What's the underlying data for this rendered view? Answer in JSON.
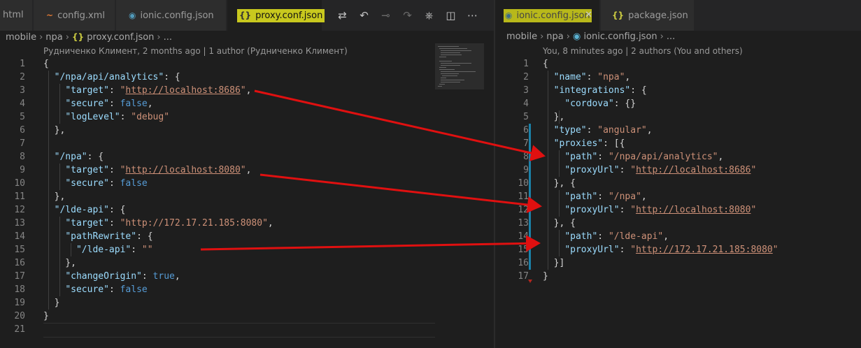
{
  "left": {
    "tabs": [
      {
        "label": "html"
      },
      {
        "label": "config.xml",
        "icon": "~"
      },
      {
        "label": "ionic.config.json",
        "icon": "◉"
      },
      {
        "label": "proxy.conf.json",
        "icon": "{}"
      }
    ],
    "breadcrumb": [
      "mobile",
      "npa",
      "proxy.conf.json",
      "..."
    ],
    "breadcrumb_icon": "{}",
    "codelens": "Рудниченко Климент, 2 months ago | 1 author (Рудниченко Климент)",
    "lines": [
      {
        "n": "1",
        "segs": [
          [
            "p",
            "{"
          ]
        ]
      },
      {
        "n": "2",
        "segs": [
          [
            "p",
            "  "
          ],
          [
            "k",
            "\"/npa/api/analytics\""
          ],
          [
            "p",
            ": {"
          ]
        ]
      },
      {
        "n": "3",
        "segs": [
          [
            "p",
            "    "
          ],
          [
            "k",
            "\"target\""
          ],
          [
            "p",
            ": "
          ],
          [
            "s",
            "\""
          ],
          [
            "u",
            "http://localhost:8686"
          ],
          [
            "s",
            "\""
          ],
          [
            "p",
            ","
          ]
        ]
      },
      {
        "n": "4",
        "segs": [
          [
            "p",
            "    "
          ],
          [
            "k",
            "\"secure\""
          ],
          [
            "p",
            ": "
          ],
          [
            "b",
            "false"
          ],
          [
            "p",
            ","
          ]
        ]
      },
      {
        "n": "5",
        "segs": [
          [
            "p",
            "    "
          ],
          [
            "k",
            "\"logLevel\""
          ],
          [
            "p",
            ": "
          ],
          [
            "s",
            "\"debug\""
          ]
        ]
      },
      {
        "n": "6",
        "segs": [
          [
            "p",
            "  },"
          ]
        ]
      },
      {
        "n": "7",
        "segs": []
      },
      {
        "n": "8",
        "segs": [
          [
            "p",
            "  "
          ],
          [
            "k",
            "\"/npa\""
          ],
          [
            "p",
            ": {"
          ]
        ]
      },
      {
        "n": "9",
        "segs": [
          [
            "p",
            "    "
          ],
          [
            "k",
            "\"target\""
          ],
          [
            "p",
            ": "
          ],
          [
            "s",
            "\""
          ],
          [
            "u",
            "http://localhost:8080"
          ],
          [
            "s",
            "\""
          ],
          [
            "p",
            ","
          ]
        ]
      },
      {
        "n": "10",
        "segs": [
          [
            "p",
            "    "
          ],
          [
            "k",
            "\"secure\""
          ],
          [
            "p",
            ": "
          ],
          [
            "b",
            "false"
          ]
        ]
      },
      {
        "n": "11",
        "segs": [
          [
            "p",
            "  },"
          ]
        ]
      },
      {
        "n": "12",
        "segs": [
          [
            "p",
            "  "
          ],
          [
            "k",
            "\"/lde-api\""
          ],
          [
            "p",
            ": {"
          ]
        ]
      },
      {
        "n": "13",
        "segs": [
          [
            "p",
            "    "
          ],
          [
            "k",
            "\"target\""
          ],
          [
            "p",
            ": "
          ],
          [
            "s",
            "\"http://172.17.21.185:8080\""
          ],
          [
            "p",
            ","
          ]
        ]
      },
      {
        "n": "14",
        "segs": [
          [
            "p",
            "    "
          ],
          [
            "k",
            "\"pathRewrite\""
          ],
          [
            "p",
            ": {"
          ]
        ]
      },
      {
        "n": "15",
        "segs": [
          [
            "p",
            "      "
          ],
          [
            "k",
            "\"/lde-api\""
          ],
          [
            "p",
            ": "
          ],
          [
            "s",
            "\"\""
          ]
        ]
      },
      {
        "n": "16",
        "segs": [
          [
            "p",
            "    },"
          ]
        ]
      },
      {
        "n": "17",
        "segs": [
          [
            "p",
            "    "
          ],
          [
            "k",
            "\"changeOrigin\""
          ],
          [
            "p",
            ": "
          ],
          [
            "b",
            "true"
          ],
          [
            "p",
            ","
          ]
        ]
      },
      {
        "n": "18",
        "segs": [
          [
            "p",
            "    "
          ],
          [
            "k",
            "\"secure\""
          ],
          [
            "p",
            ": "
          ],
          [
            "b",
            "false"
          ]
        ]
      },
      {
        "n": "19",
        "segs": [
          [
            "p",
            "  }"
          ]
        ]
      },
      {
        "n": "20",
        "segs": [
          [
            "p",
            "}"
          ]
        ]
      },
      {
        "n": "21",
        "segs": []
      }
    ]
  },
  "right": {
    "tabs": [
      {
        "label": "ionic.config.json",
        "icon": "◉"
      },
      {
        "label": "package.json",
        "icon": "{}"
      }
    ],
    "breadcrumb": [
      "mobile",
      "npa",
      "ionic.config.json",
      "..."
    ],
    "codelens": "You, 8 minutes ago | 2 authors (You and others)",
    "lines": [
      {
        "n": "1",
        "segs": [
          [
            "p",
            "{"
          ]
        ]
      },
      {
        "n": "2",
        "segs": [
          [
            "p",
            "  "
          ],
          [
            "k",
            "\"name\""
          ],
          [
            "p",
            ": "
          ],
          [
            "s",
            "\"npa\""
          ],
          [
            "p",
            ","
          ]
        ]
      },
      {
        "n": "3",
        "segs": [
          [
            "p",
            "  "
          ],
          [
            "k",
            "\"integrations\""
          ],
          [
            "p",
            ": {"
          ]
        ]
      },
      {
        "n": "4",
        "segs": [
          [
            "p",
            "    "
          ],
          [
            "k",
            "\"cordova\""
          ],
          [
            "p",
            ": {}"
          ]
        ]
      },
      {
        "n": "5",
        "segs": [
          [
            "p",
            "  },"
          ]
        ]
      },
      {
        "n": "6",
        "segs": [
          [
            "p",
            "  "
          ],
          [
            "k",
            "\"type\""
          ],
          [
            "p",
            ": "
          ],
          [
            "s",
            "\"angular\""
          ],
          [
            "p",
            ","
          ]
        ]
      },
      {
        "n": "7",
        "segs": [
          [
            "p",
            "  "
          ],
          [
            "k",
            "\"proxies\""
          ],
          [
            "p",
            ": [{"
          ]
        ]
      },
      {
        "n": "8",
        "segs": [
          [
            "p",
            "    "
          ],
          [
            "k",
            "\"path\""
          ],
          [
            "p",
            ": "
          ],
          [
            "s",
            "\"/npa/api/analytics\""
          ],
          [
            "p",
            ","
          ]
        ]
      },
      {
        "n": "9",
        "segs": [
          [
            "p",
            "    "
          ],
          [
            "k",
            "\"proxyUrl\""
          ],
          [
            "p",
            ": "
          ],
          [
            "s",
            "\""
          ],
          [
            "u",
            "http://localhost:8686"
          ],
          [
            "s",
            "\""
          ]
        ]
      },
      {
        "n": "10",
        "segs": [
          [
            "p",
            "  }, {"
          ]
        ]
      },
      {
        "n": "11",
        "segs": [
          [
            "p",
            "    "
          ],
          [
            "k",
            "\"path\""
          ],
          [
            "p",
            ": "
          ],
          [
            "s",
            "\"/npa\""
          ],
          [
            "p",
            ","
          ]
        ]
      },
      {
        "n": "12",
        "segs": [
          [
            "p",
            "    "
          ],
          [
            "k",
            "\"proxyUrl\""
          ],
          [
            "p",
            ": "
          ],
          [
            "s",
            "\""
          ],
          [
            "u",
            "http://localhost:8080"
          ],
          [
            "s",
            "\""
          ]
        ]
      },
      {
        "n": "13",
        "segs": [
          [
            "p",
            "  }, {"
          ]
        ]
      },
      {
        "n": "14",
        "segs": [
          [
            "p",
            "    "
          ],
          [
            "k",
            "\"path\""
          ],
          [
            "p",
            ": "
          ],
          [
            "s",
            "\"/lde-api\""
          ],
          [
            "p",
            ","
          ]
        ]
      },
      {
        "n": "15",
        "segs": [
          [
            "p",
            "    "
          ],
          [
            "k",
            "\"proxyUrl\""
          ],
          [
            "p",
            ": "
          ],
          [
            "s",
            "\""
          ],
          [
            "u",
            "http://172.17.21.185:8080"
          ],
          [
            "s",
            "\""
          ]
        ]
      },
      {
        "n": "16",
        "segs": [
          [
            "p",
            "  }]"
          ]
        ]
      },
      {
        "n": "17",
        "segs": [
          [
            "p",
            "}"
          ]
        ]
      }
    ]
  },
  "editor_actions": [
    "compare-changes-icon",
    "go-back-icon",
    "git-commit-icon",
    "go-forward-icon",
    "open-timeline-icon",
    "split-editor-icon",
    "more-actions-icon"
  ],
  "colors": {
    "annotation_highlight": "#c8c81e",
    "arrow": "#e01010",
    "git_modified_bar": "#1b81a8"
  }
}
